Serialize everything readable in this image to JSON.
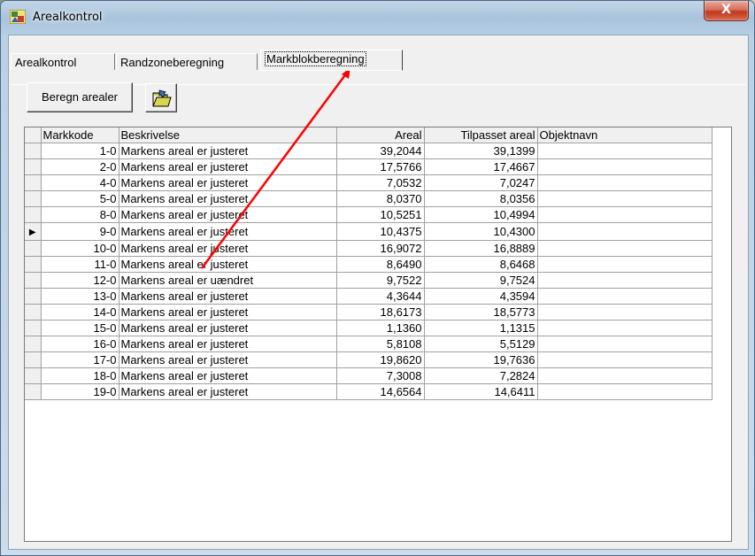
{
  "window": {
    "title": "Arealkontrol",
    "close_label": "X"
  },
  "tabs": [
    {
      "label": "Arealkontrol",
      "active": false
    },
    {
      "label": "Randzoneberegning",
      "active": false
    },
    {
      "label": "Markblokberegning",
      "active": true
    }
  ],
  "toolbar": {
    "beregn_label": "Beregn arealer",
    "folder_icon": "open-folder-icon"
  },
  "grid": {
    "columns": [
      "Markkode",
      "Beskrivelse",
      "Areal",
      "Tilpasset areal",
      "Objektnavn"
    ],
    "current_row_index": 5,
    "rows": [
      {
        "markkode": "1-0",
        "beskrivelse": "Markens areal er justeret",
        "areal": "39,2044",
        "tilpasset": "39,1399",
        "objektnavn": ""
      },
      {
        "markkode": "2-0",
        "beskrivelse": "Markens areal er justeret",
        "areal": "17,5766",
        "tilpasset": "17,4667",
        "objektnavn": ""
      },
      {
        "markkode": "4-0",
        "beskrivelse": "Markens areal er justeret",
        "areal": "7,0532",
        "tilpasset": "7,0247",
        "objektnavn": ""
      },
      {
        "markkode": "5-0",
        "beskrivelse": "Markens areal er justeret",
        "areal": "8,0370",
        "tilpasset": "8,0356",
        "objektnavn": ""
      },
      {
        "markkode": "8-0",
        "beskrivelse": "Markens areal er justeret",
        "areal": "10,5251",
        "tilpasset": "10,4994",
        "objektnavn": ""
      },
      {
        "markkode": "9-0",
        "beskrivelse": "Markens areal er justeret",
        "areal": "10,4375",
        "tilpasset": "10,4300",
        "objektnavn": ""
      },
      {
        "markkode": "10-0",
        "beskrivelse": "Markens areal er justeret",
        "areal": "16,9072",
        "tilpasset": "16,8889",
        "objektnavn": ""
      },
      {
        "markkode": "11-0",
        "beskrivelse": "Markens areal er justeret",
        "areal": "8,6490",
        "tilpasset": "8,6468",
        "objektnavn": ""
      },
      {
        "markkode": "12-0",
        "beskrivelse": "Markens areal er uændret",
        "areal": "9,7522",
        "tilpasset": "9,7524",
        "objektnavn": ""
      },
      {
        "markkode": "13-0",
        "beskrivelse": "Markens areal er justeret",
        "areal": "4,3644",
        "tilpasset": "4,3594",
        "objektnavn": ""
      },
      {
        "markkode": "14-0",
        "beskrivelse": "Markens areal er justeret",
        "areal": "18,6173",
        "tilpasset": "18,5773",
        "objektnavn": ""
      },
      {
        "markkode": "15-0",
        "beskrivelse": "Markens areal er justeret",
        "areal": "1,1360",
        "tilpasset": "1,1315",
        "objektnavn": ""
      },
      {
        "markkode": "16-0",
        "beskrivelse": "Markens areal er justeret",
        "areal": "5,8108",
        "tilpasset": "5,5129",
        "objektnavn": ""
      },
      {
        "markkode": "17-0",
        "beskrivelse": "Markens areal er justeret",
        "areal": "19,8620",
        "tilpasset": "19,7636",
        "objektnavn": ""
      },
      {
        "markkode": "18-0",
        "beskrivelse": "Markens areal er justeret",
        "areal": "7,3008",
        "tilpasset": "7,2824",
        "objektnavn": ""
      },
      {
        "markkode": "19-0",
        "beskrivelse": "Markens areal er justeret",
        "areal": "14,6564",
        "tilpasset": "14,6411",
        "objektnavn": ""
      }
    ]
  },
  "annotation": {
    "arrow_color": "#ff0000"
  }
}
